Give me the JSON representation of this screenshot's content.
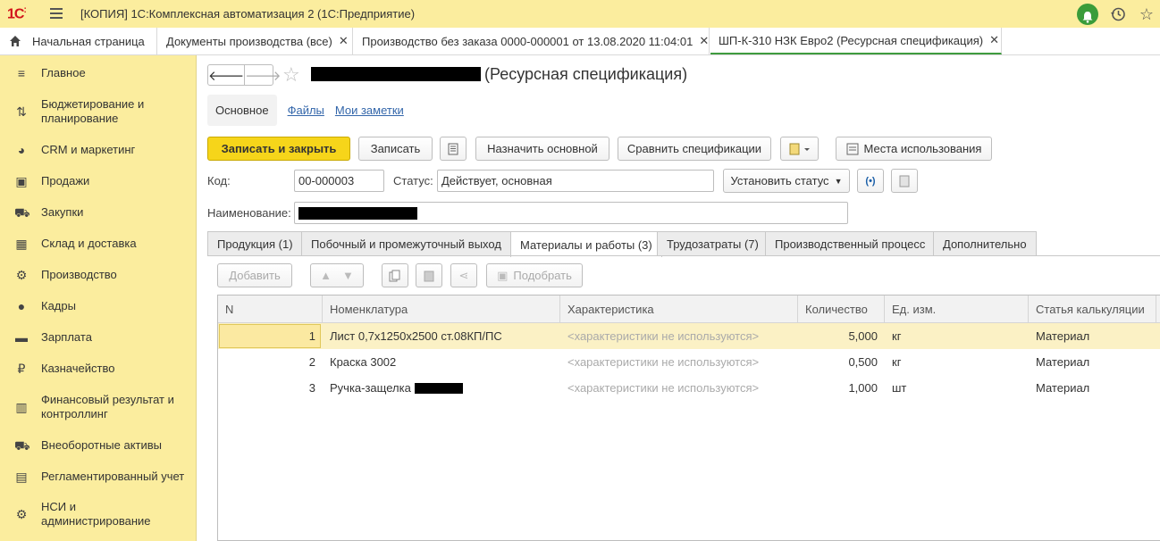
{
  "titlebar": {
    "logo": "1С",
    "title": "[КОПИЯ] 1С:Комплексная автоматизация 2  (1С:Предприятие)",
    "icons": [
      "bell-icon",
      "history-icon",
      "star-icon"
    ]
  },
  "tabs": [
    {
      "label": "Начальная страница"
    },
    {
      "label": "Документы производства (все)"
    },
    {
      "label": "Производство без заказа 0000-000001 от 13.08.2020 11:04:01"
    },
    {
      "label": "ШП-К-310 НЗК Евро2 (Ресурсная спецификация)"
    }
  ],
  "sidebar": {
    "items": [
      {
        "label": "Главное",
        "icon": "menu-lines-icon"
      },
      {
        "label": "Бюджетирование и планирование",
        "icon": "budget-icon"
      },
      {
        "label": "CRM и маркетинг",
        "icon": "pie-icon"
      },
      {
        "label": "Продажи",
        "icon": "bag-icon"
      },
      {
        "label": "Закупки",
        "icon": "cart-icon"
      },
      {
        "label": "Склад и доставка",
        "icon": "grid-icon"
      },
      {
        "label": "Производство",
        "icon": "factory-icon"
      },
      {
        "label": "Кадры",
        "icon": "person-icon"
      },
      {
        "label": "Зарплата",
        "icon": "wallet-icon"
      },
      {
        "label": "Казначейство",
        "icon": "ruble-icon"
      },
      {
        "label": "Финансовый результат и контроллинг",
        "icon": "bars-icon"
      },
      {
        "label": "Внеоборотные активы",
        "icon": "truck-icon"
      },
      {
        "label": "Регламентированный учет",
        "icon": "ledger-icon"
      },
      {
        "label": "НСИ и администрирование",
        "icon": "gear-icon"
      }
    ]
  },
  "form": {
    "title_suffix": "(Ресурсная спецификация)",
    "subnav": {
      "main": "Основное",
      "files": "Файлы",
      "notes": "Мои заметки"
    },
    "toolbar": {
      "save_close": "Записать и закрыть",
      "save": "Записать",
      "set_main": "Назначить основной",
      "compare": "Сравнить спецификации",
      "usage": "Места использования"
    },
    "code_label": "Код:",
    "code_value": "00-000003",
    "status_label": "Статус:",
    "status_value": "Действует, основная",
    "set_status": "Установить статус",
    "name_label": "Наименование:",
    "tabs": [
      {
        "label": "Продукция (1)"
      },
      {
        "label": "Побочный и промежуточный выход"
      },
      {
        "label": "Материалы и работы (3)"
      },
      {
        "label": "Трудозатраты (7)"
      },
      {
        "label": "Производственный процесс"
      },
      {
        "label": "Дополнительно"
      }
    ],
    "grid_toolbar": {
      "add": "Добавить",
      "pick": "Подобрать"
    }
  },
  "table": {
    "columns": [
      "N",
      "Номенклатура",
      "Характеристика",
      "Количество",
      "Ед. изм.",
      "Статья калькуляции"
    ],
    "rows": [
      {
        "n": "1",
        "item": "Лист 0,7х1250х2500 ст.08КП/ПС",
        "char": "<характеристики не используются>",
        "qty": "5,000",
        "unit": "кг",
        "article": "Материал"
      },
      {
        "n": "2",
        "item": "Краска 3002",
        "char": "<характеристики не используются>",
        "qty": "0,500",
        "unit": "кг",
        "article": "Материал"
      },
      {
        "n": "3",
        "item": "Ручка-защелка",
        "char": "<характеристики не используются>",
        "qty": "1,000",
        "unit": "шт",
        "article": "Материал"
      }
    ]
  }
}
